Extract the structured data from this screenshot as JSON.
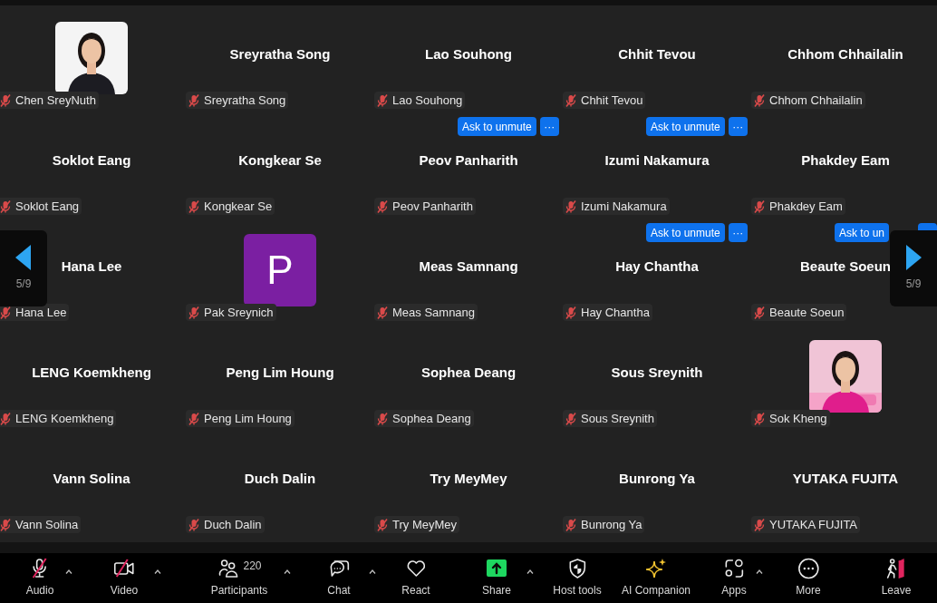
{
  "gallery": {
    "tiles": [
      {
        "label": "Chen SreyNuth",
        "muted": true
      },
      {
        "display_name": "Sreyratha Song",
        "label": "Sreyratha Song",
        "muted": true
      },
      {
        "display_name": "Lao Souhong",
        "label": "Lao Souhong",
        "muted": true,
        "ask": {
          "label": "Ask to unmute",
          "more": "···"
        }
      },
      {
        "display_name": "Chhit Tevou",
        "label": "Chhit Tevou",
        "muted": true,
        "ask": {
          "label": "Ask to unmute",
          "more": "···"
        }
      },
      {
        "display_name": "Chhom Chhailalin",
        "label": "Chhom Chhailalin",
        "muted": true
      },
      {
        "display_name": "Soklot Eang",
        "label": "Soklot Eang",
        "muted": true
      },
      {
        "display_name": "Kongkear Se",
        "label": "Kongkear Se",
        "muted": true
      },
      {
        "display_name": "Peov Panharith",
        "label": "Peov Panharith",
        "muted": true
      },
      {
        "display_name": "Izumi Nakamura",
        "label": "Izumi Nakamura",
        "muted": true,
        "ask": {
          "label": "Ask to unmute",
          "more": "···"
        }
      },
      {
        "display_name": "Phakdey Eam",
        "label": "Phakdey Eam",
        "muted": true,
        "ask": {
          "label": "Ask to un"
        }
      },
      {
        "display_name": "Hana Lee",
        "label": "Hana Lee",
        "muted": true
      },
      {
        "label": "Pak Sreynich",
        "muted": true,
        "avatar": {
          "kind": "initial",
          "text": "P",
          "color": "#7b1fa2"
        }
      },
      {
        "display_name": "Meas Samnang",
        "label": "Meas Samnang",
        "muted": true
      },
      {
        "display_name": "Hay Chantha",
        "label": "Hay Chantha",
        "muted": true
      },
      {
        "display_name": "Beaute Soeun",
        "label": "Beaute Soeun",
        "muted": true
      },
      {
        "display_name": "LENG Koemkheng",
        "label": "LENG Koemkheng",
        "muted": true
      },
      {
        "display_name": "Peng Lim Houng",
        "label": "Peng Lim Houng",
        "muted": true
      },
      {
        "display_name": "Sophea Deang",
        "label": "Sophea Deang",
        "muted": true
      },
      {
        "display_name": "Sous Sreynith",
        "label": "Sous Sreynith",
        "muted": true
      },
      {
        "label": "Sok Kheng",
        "muted": true
      },
      {
        "display_name": "Vann Solina",
        "label": "Vann Solina",
        "muted": true
      },
      {
        "display_name": "Duch Dalin",
        "label": "Duch Dalin",
        "muted": true
      },
      {
        "display_name": "Try MeyMey",
        "label": "Try MeyMey",
        "muted": true
      },
      {
        "display_name": "Bunrong Ya",
        "label": "Bunrong Ya",
        "muted": true
      },
      {
        "display_name": "YUTAKA FUJITA",
        "label": "YUTAKA FUJITA",
        "muted": true
      }
    ]
  },
  "page_nav": [
    {
      "page": "5/9"
    },
    {
      "page": "5/9"
    }
  ],
  "toolbar": [
    {
      "kind": "audio",
      "label": "Audio",
      "off": true,
      "has_menu": true
    },
    {
      "kind": "video",
      "label": "Video",
      "off": true,
      "has_menu": true
    },
    {
      "kind": "participants",
      "label": "Participants",
      "count": "220",
      "has_menu": true
    },
    {
      "kind": "chat",
      "label": "Chat",
      "has_menu": true
    },
    {
      "kind": "react",
      "label": "React",
      "has_menu": false
    },
    {
      "kind": "share",
      "label": "Share",
      "has_menu": true
    },
    {
      "kind": "host",
      "label": "Host tools",
      "has_menu": false
    },
    {
      "kind": "ai",
      "label": "AI Companion",
      "has_menu": false
    },
    {
      "kind": "apps",
      "label": "Apps",
      "has_menu": true
    },
    {
      "kind": "more",
      "label": "More",
      "has_menu": false
    },
    {
      "kind": "leave",
      "label": "Leave",
      "has_menu": false
    }
  ]
}
